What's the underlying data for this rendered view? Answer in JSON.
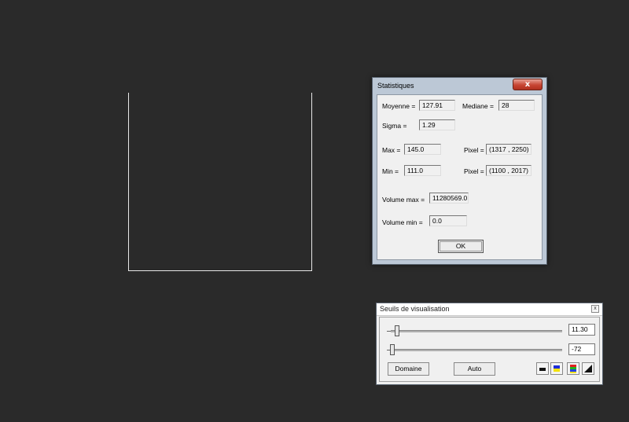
{
  "stats": {
    "title": "Statistiques",
    "close_label": "x",
    "moyenne_label": "Moyenne =",
    "moyenne_value": "127.91",
    "mediane_label": "Mediane =",
    "mediane_value": "28",
    "sigma_label": "Sigma =",
    "sigma_value": "1.29",
    "max_label": "Max =",
    "max_value": "145.0",
    "max_pixel_label": "Pixel =",
    "max_pixel_value": "(1317 , 2250)",
    "min_label": "Min =",
    "min_value": "111.0",
    "min_pixel_label": "Pixel =",
    "min_pixel_value": "(1100 , 2017)",
    "volume_max_label": "Volume max =",
    "volume_max_value": "11280569.0",
    "volume_min_label": "Volume min =",
    "volume_min_value": "0.0",
    "ok_label": "OK"
  },
  "seuils": {
    "title": "Seuils de visualisation",
    "close_label": "x",
    "high_value": "11.30",
    "low_value": "-72",
    "domaine_label": "Domaine",
    "auto_label": "Auto"
  },
  "colors": {
    "background": "#2a2a2a",
    "image_outline": "#e8e8e8",
    "close_button": "#c74533",
    "palette_blue": "#1f2fd8",
    "palette_yellow": "#f2e20a"
  },
  "icons": {
    "palette_gray": "gray-palette-icon",
    "palette_color2": "blue-yellow-palette-icon",
    "palette_rainbow": "rainbow-palette-icon",
    "palette_ramp": "ramp-icon"
  }
}
